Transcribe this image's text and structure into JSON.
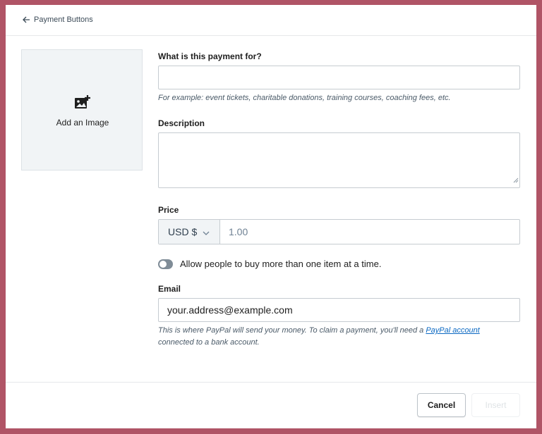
{
  "header": {
    "back_label": "Payment Buttons"
  },
  "image_box": {
    "label": "Add an Image"
  },
  "form": {
    "title_label": "What is this payment for?",
    "title_value": "",
    "title_help": "For example: event tickets, charitable donations, training courses, coaching fees, etc.",
    "description_label": "Description",
    "description_value": "",
    "price_label": "Price",
    "currency": "USD $",
    "price_placeholder": "1.00",
    "multiple_toggle_label": "Allow people to buy more than one item at a time.",
    "multiple_toggle_on": false,
    "email_label": "Email",
    "email_value": "your.address@example.com",
    "email_help_before": "This is where PayPal will send your money. To claim a payment, you'll need a ",
    "email_help_link": "PayPal account",
    "email_help_after": "connected to a bank account."
  },
  "footer": {
    "cancel_label": "Cancel",
    "insert_label": "Insert"
  },
  "colors": {
    "backdrop": "#b05466",
    "link": "#0a68c2",
    "toggle_off": "#7f8c97"
  },
  "icons": {
    "back": "arrow-left-icon",
    "add_image": "image-plus-icon",
    "dropdown": "chevron-down-icon",
    "resize": "resize-grip-icon"
  }
}
